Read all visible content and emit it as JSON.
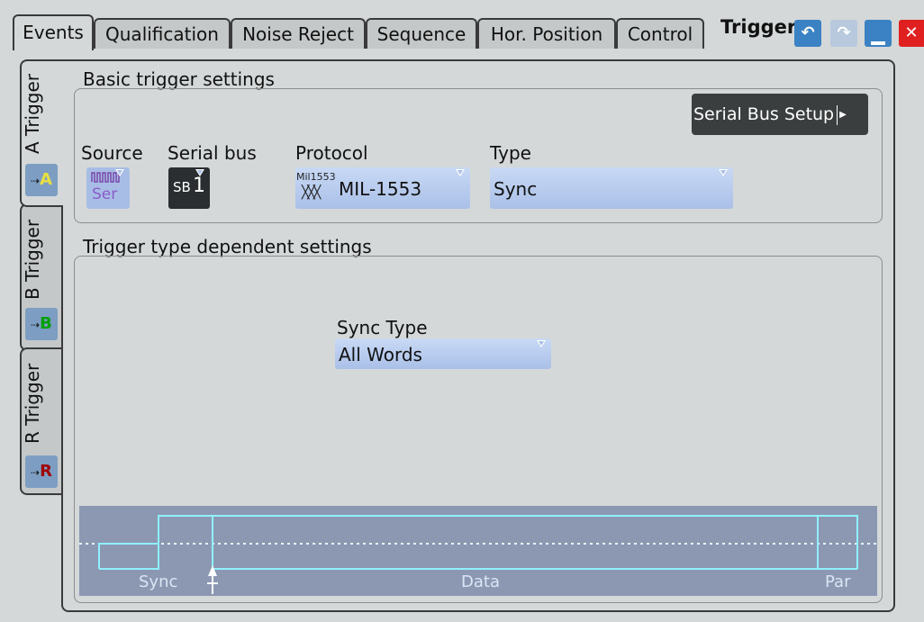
{
  "tabs": [
    "Events",
    "Qualification",
    "Noise Reject",
    "Sequence",
    "Hor. Position",
    "Control"
  ],
  "header": {
    "title": "Trigger"
  },
  "side_tabs": [
    {
      "label": "A Trigger",
      "letter": "A",
      "color": "#e8e040"
    },
    {
      "label": "B Trigger",
      "letter": "B",
      "color": "#00a000"
    },
    {
      "label": "R Trigger",
      "letter": "R",
      "color": "#a00000"
    }
  ],
  "basic": {
    "title": "Basic trigger settings",
    "serial_bus_setup_label": "Serial Bus Setup",
    "source": {
      "label": "Source",
      "icon_top": "Ser"
    },
    "serial_bus": {
      "label": "Serial bus",
      "value_prefix": "SB",
      "value_num": "1"
    },
    "protocol": {
      "label": "Protocol",
      "icon_text": "Mil1553",
      "value": "MIL-1553"
    },
    "type": {
      "label": "Type",
      "value": "Sync"
    }
  },
  "dependent": {
    "title": "Trigger type dependent settings",
    "sync_type": {
      "label": "Sync Type",
      "value": "All Words"
    }
  },
  "diagram": {
    "labels": [
      "Sync",
      "Data",
      "Par"
    ]
  }
}
